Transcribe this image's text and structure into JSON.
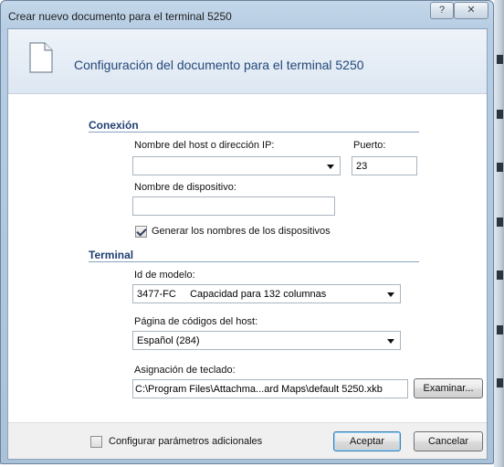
{
  "window": {
    "title": "Crear nuevo documento para el terminal 5250",
    "help_glyph": "?",
    "close_glyph": "✕"
  },
  "header": {
    "icon": "document-icon",
    "title": "Configuración del documento para el terminal 5250"
  },
  "connection": {
    "section_title": "Conexión",
    "host_label": "Nombre del host o dirección IP:",
    "host_value": "",
    "port_label": "Puerto:",
    "port_value": "23",
    "device_label": "Nombre de dispositivo:",
    "device_value": "",
    "generate_names_label": "Generar los nombres de los dispositivos",
    "generate_names_checked": true
  },
  "terminal": {
    "section_title": "Terminal",
    "model_label": "Id de modelo:",
    "model_value": "3477-FC     Capacidad para 132 columnas",
    "codepage_label": "Página de códigos del host:",
    "codepage_value": "Español (284)",
    "keymap_label": "Asignación de teclado:",
    "keymap_value": "C:\\Program Files\\Attachma...ard Maps\\default 5250.xkb",
    "browse_label": "Examinar..."
  },
  "footer": {
    "extra_params_label": "Configurar parámetros adicionales",
    "extra_params_checked": false,
    "accept_label": "Aceptar",
    "cancel_label": "Cancelar"
  },
  "colors": {
    "section_title": "#1f3f72",
    "header_title": "#24487a",
    "default_button_border": "#3c7fb1"
  }
}
